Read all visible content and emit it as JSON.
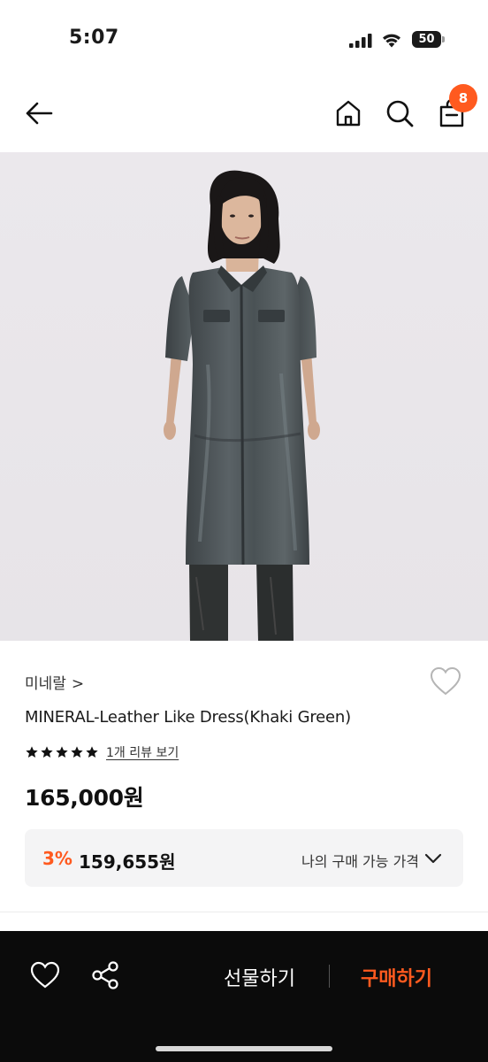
{
  "status_bar": {
    "time": "5:07",
    "battery_level": "50",
    "icons": [
      "cellular-signal-icon",
      "wifi-icon",
      "battery-icon"
    ]
  },
  "header": {
    "icons": [
      "back-arrow-icon",
      "home-icon",
      "search-icon",
      "shopping-bag-icon"
    ],
    "cart_count": "8"
  },
  "product": {
    "brand": "미네랄",
    "brand_chevron": ">",
    "name": "MINERAL-Leather Like Dress(Khaki Green)",
    "rating": 5,
    "review_link": "1개 리뷰 보기",
    "price": "165,000원"
  },
  "benefit": {
    "discount_rate": "3%",
    "discounted_price": "159,655원",
    "label": "나의 구매 가능 가격"
  },
  "bottom_bar": {
    "gift_label": "선물하기",
    "buy_label": "구매하기",
    "icons": [
      "heart-outline-icon",
      "share-icon"
    ]
  },
  "colors": {
    "accent": "#ff5a1f",
    "bottom_bar_bg": "#0b0b0b",
    "benefit_bg": "#f4f4f5"
  }
}
